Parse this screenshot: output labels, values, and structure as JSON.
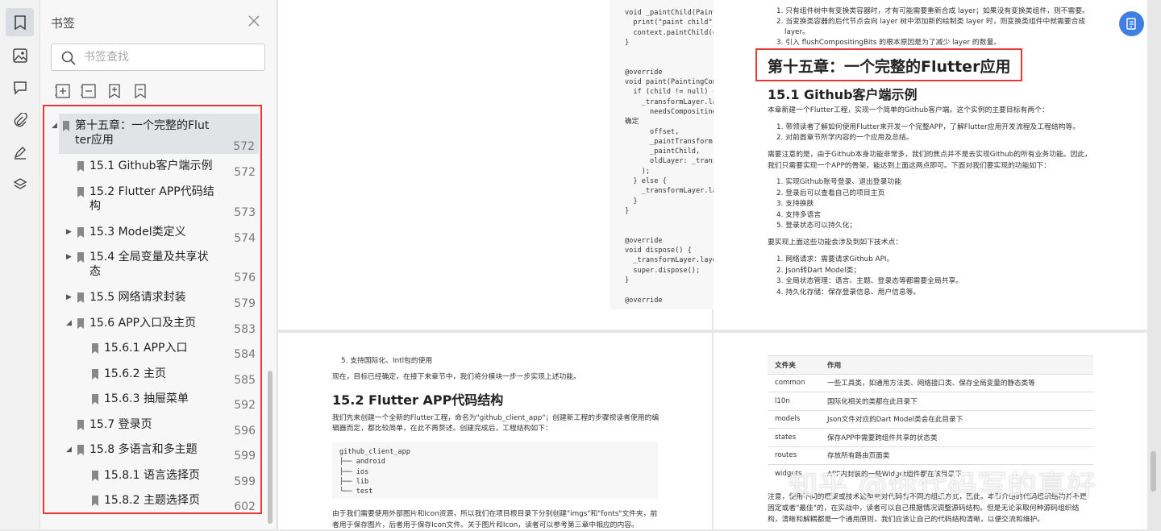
{
  "sidebar": {
    "title": "书签",
    "search_placeholder": "书签查找",
    "rail_icons": [
      "bookmark-icon",
      "image-icon",
      "comment-icon",
      "attachment-icon",
      "signature-icon",
      "layers-icon"
    ],
    "toolbar_icons": [
      "expand-all-icon",
      "collapse-all-icon",
      "add-bookmark-icon",
      "bookmark-outline-icon"
    ],
    "items": [
      {
        "line1": "第十五章：一个完整的Flut",
        "line2": "ter应用",
        "page": "572",
        "level": 0,
        "toggle": "expanded",
        "selected": true
      },
      {
        "line1": "15.1 Github客户端示例",
        "page": "572",
        "level": 1,
        "toggle": "none"
      },
      {
        "line1": "15.2 Flutter APP代码结",
        "line2": "构",
        "page": "573",
        "level": 1,
        "toggle": "none"
      },
      {
        "line1": "15.3 Model类定义",
        "page": "574",
        "level": 1,
        "toggle": "collapsed"
      },
      {
        "line1": "15.4 全局变量及共享状",
        "line2": "态",
        "page": "576",
        "level": 1,
        "toggle": "collapsed"
      },
      {
        "line1": "15.5 网络请求封装",
        "page": "579",
        "level": 1,
        "toggle": "collapsed"
      },
      {
        "line1": "15.6 APP入口及主页",
        "page": "583",
        "level": 1,
        "toggle": "expanded"
      },
      {
        "line1": "15.6.1 APP入口",
        "page": "584",
        "level": 2,
        "toggle": "none"
      },
      {
        "line1": "15.6.2 主页",
        "page": "585",
        "level": 2,
        "toggle": "none"
      },
      {
        "line1": "15.6.3 抽屉菜单",
        "page": "592",
        "level": 2,
        "toggle": "none"
      },
      {
        "line1": "15.7 登录页",
        "page": "596",
        "level": 1,
        "toggle": "none"
      },
      {
        "line1": "15.8 多语言和多主题",
        "page": "599",
        "level": 1,
        "toggle": "expanded"
      },
      {
        "line1": "15.8.1 语言选择页",
        "page": "599",
        "level": 2,
        "toggle": "none"
      },
      {
        "line1": "15.8.2 主题选择页",
        "page": "602",
        "level": 2,
        "toggle": "none"
      }
    ]
  },
  "page1": {
    "code": "void _paintChild(PaintingContext context, Offset offset) {\n  print(\"paint child\");\n  context.paintChild(child!, offset);\n}\n\n\n@override\nvoid paint(PaintingContext context, Offset offset) {\n  if (child != null) {\n    _transformLayer.layer = context.pushTransform(\n      needsCompositing, // pipelineOwner.flushCompositingBits(); 执行后这个值就能\n确定\n      offset,\n      _paintTransform!,\n      _paintChild,\n      oldLayer: _transformLayer.layer,\n    );\n  } else {\n    _transformLayer.layer = null;\n  }\n}\n\n\n@override\nvoid dispose() {\n  _transformLayer.layer = null;\n  super.dispose();\n}\n\n@override"
  },
  "page2": {
    "top_lines": [
      "1. 只有组件树中有变换类容器时，才有可能需要重新合成 layer；如果没有变换类组件，则不需要。",
      "2. 当变换类容器的后代节点会向 layer 树中添加新的绘制类 layer 时，则变换类组件中就需要合成",
      "layer。",
      "3. 引入 flushCompositingBits 的根本原因是为了减少 layer 的数量。"
    ],
    "chapter_title": "第十五章：一个完整的Flutter应用",
    "section_title": "15.1 Github客户端示例",
    "intro": "本章新建一个Flutter工程，实现一个简单的Github客户端。这个实例的主要目标有两个：",
    "goals": [
      "1. 带领读者了解如何使用Flutter来开发一个完整APP，了解Flutter应用开发流程及工程结构等。",
      "2. 对前面章节所学内容的一个应用及总结。"
    ],
    "para": [
      "需要注意的是，由于Github本身功能非常多，我们的焦点并不是去实现Github的所有业务功能。因此，",
      "我们只需要实现一个APP的骨架，能达到上面这两点即可。下面对我们要实现的功能如下："
    ],
    "features": [
      "1. 实现Github账号登录、退出登录功能",
      "2. 登录后可以查看自己的项目主页",
      "3. 支持换肤",
      "4. 支持多语言",
      "5. 登录状态可以持久化；"
    ],
    "tech_intro": "要实现上面这些功能会涉及到如下技术点：",
    "tech": [
      "1. 网络请求：需要请求Github API。",
      "2. Json转Dart Model类；",
      "3. 全局状态管理：语言、主题、登录态等都需要全局共享。",
      "4. 持久化存储：保存登录信息、用户信息等。"
    ]
  },
  "page3": {
    "item5": "5. 支持国际化、Intl包的使用",
    "p1": "现在，目标已经确定，在接下来章节中，我们将分模块一步一步实现上述功能。",
    "section_title": "15.2 Flutter APP代码结构",
    "p2": [
      "我们先来创建一个全新的Flutter工程，命名为\"github_client_app\"；创建新工程的步骤视读者使用的编",
      "辑器而定，都比较简单，在此不再赘述。创建完成后，工程结构如下："
    ],
    "tree": "github_client_app\n├── android\n├── ios\n├── lib\n└── test",
    "p3": [
      "由于我们需要使用外部图片和Icon资源，所以我们在项目根目录下分别创建\"imgs\"和\"fonts\"文件夹，前",
      "者用于保存图片，后者用于保存Icon文件。关于图片和Icon，读者可以参考第三章中相应的内容。"
    ]
  },
  "page4": {
    "headers": [
      "文件夹",
      "作用"
    ],
    "rows": [
      [
        "common",
        "一些工具类，如通用方法类、网络接口类、保存全局变量的静态类等"
      ],
      [
        "l10n",
        "国际化相关的类都在此目录下"
      ],
      [
        "models",
        "Json文件对应的Dart Model类会在此目录下"
      ],
      [
        "states",
        "保存APP中需要跨组件共享的状态类"
      ],
      [
        "routes",
        "存放所有路由页面类"
      ],
      [
        "widgets",
        "APP内封装的一些Widget组件都在该目录下"
      ]
    ],
    "note": [
      "注意，使用不同的框架或技术选型会对代码有不同的组织方式，因此，本节介绍的代码组织结构并不是",
      "固定或者\"最佳\"的，在实战中，读者可以自己根据情况调整源码结构。但是无论采取何种源码组织结",
      "构，清晰和解耦都是一个通用原则，我们应该让自己的代码结构清晰，以便交流和维护。"
    ]
  },
  "watermark": "知乎 @你代码写的真好",
  "colors": {
    "highlight": "#e53935",
    "accent": "#3f7fe0"
  }
}
